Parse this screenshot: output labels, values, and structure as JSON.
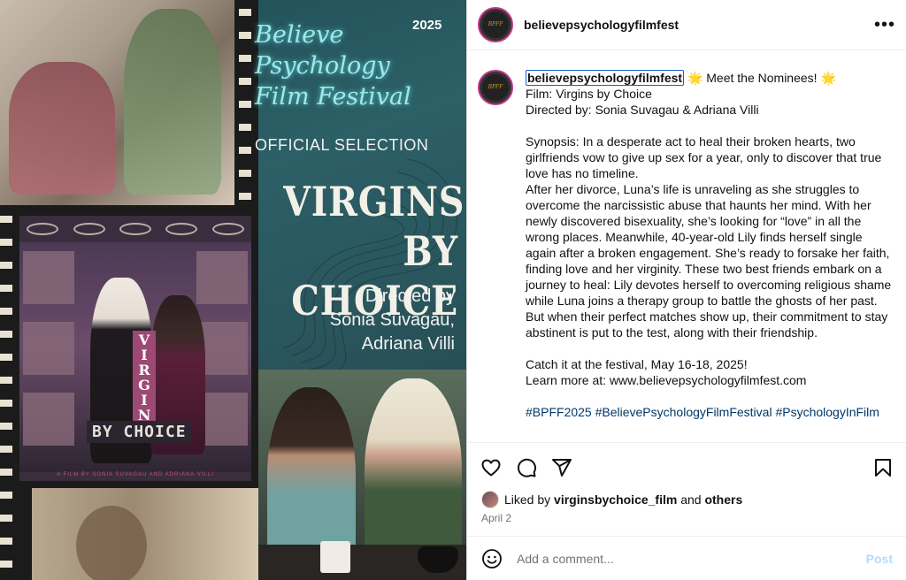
{
  "poster": {
    "festival_title": "Believe Psychology Film Festival",
    "year": "2025",
    "official_selection": "OFFICIAL SELECTION",
    "movie_title_line1": "VIRGINS",
    "movie_title_line2": "BY CHOICE",
    "directed_by_lines": [
      "Directed by",
      "Sonia Suvagau,",
      "Adriana Villi"
    ],
    "inner_poster_vertical_title": "VIRGINS",
    "inner_poster_by_choice": "BY CHOICE",
    "inner_poster_credits": "A FILM BY SONIA SUVAGAU AND ADRIANA VILLI"
  },
  "header": {
    "username": "believepsychologyfilmfest",
    "avatar_text": "Believe Psychology Film Festival",
    "more_icon": "more-horizontal-icon"
  },
  "caption": {
    "username": "believepsychologyfilmfest",
    "body": " 🌟 Meet the Nominees! 🌟\nFilm: Virgins by Choice\nDirected by: Sonia Suvagau & Adriana Villi\n\nSynopsis: In a desperate act to heal their broken hearts, two girlfriends vow to give up sex for a year, only to discover that true love has no timeline.\nAfter her divorce, Luna’s life is unraveling as she struggles to overcome the narcissistic abuse that haunts her mind. With her newly discovered bisexuality, she’s looking for “love” in all the wrong places. Meanwhile, 40-year-old Lily finds herself single again after a broken engagement. She’s ready to forsake her faith, finding love and her virginity. These two best friends embark on a journey to heal: Lily devotes herself to overcoming religious shame while Luna joins a therapy group to battle the ghosts of her past. But when their perfect matches show up, their commitment to stay abstinent is put to the test, along with their friendship.\n\nCatch it at the festival, May 16-18, 2025!\nLearn more at: www.believepsychologyfilmfest.com\n\n",
    "hashtags": "#BPFF2025 #BelievePsychologyFilmFestival #PsychologyInFilm"
  },
  "actions": {
    "icons": [
      "heart-icon",
      "comment-icon",
      "share-icon",
      "bookmark-icon"
    ]
  },
  "likes": {
    "prefix": "Liked by",
    "user": "virginsbychoice_film",
    "middle": "and",
    "others": "others"
  },
  "date": "April 2",
  "comment": {
    "placeholder": "Add a comment...",
    "post_label": "Post"
  }
}
